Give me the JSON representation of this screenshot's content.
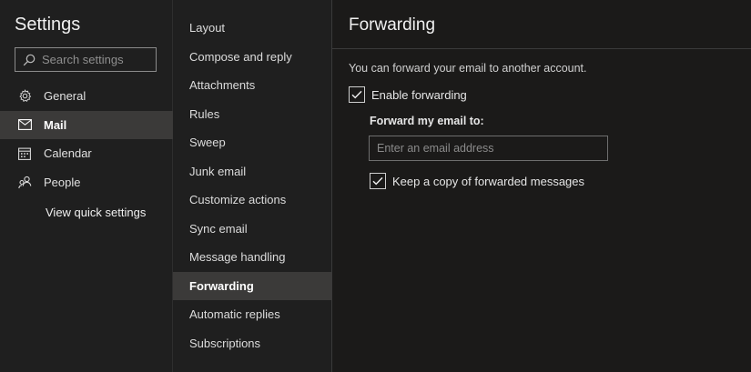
{
  "sidebar": {
    "title": "Settings",
    "search_placeholder": "Search settings",
    "items": [
      {
        "label": "General",
        "icon": "gear-icon",
        "active": false
      },
      {
        "label": "Mail",
        "icon": "mail-icon",
        "active": true
      },
      {
        "label": "Calendar",
        "icon": "calendar-icon",
        "active": false
      },
      {
        "label": "People",
        "icon": "people-icon",
        "active": false
      }
    ],
    "quick_settings": "View quick settings"
  },
  "mail_nav": {
    "items": [
      {
        "label": "Layout",
        "active": false
      },
      {
        "label": "Compose and reply",
        "active": false
      },
      {
        "label": "Attachments",
        "active": false
      },
      {
        "label": "Rules",
        "active": false
      },
      {
        "label": "Sweep",
        "active": false
      },
      {
        "label": "Junk email",
        "active": false
      },
      {
        "label": "Customize actions",
        "active": false
      },
      {
        "label": "Sync email",
        "active": false
      },
      {
        "label": "Message handling",
        "active": false
      },
      {
        "label": "Forwarding",
        "active": true
      },
      {
        "label": "Automatic replies",
        "active": false
      },
      {
        "label": "Subscriptions",
        "active": false
      }
    ]
  },
  "panel": {
    "title": "Forwarding",
    "description": "You can forward your email to another account.",
    "enable_label": "Enable forwarding",
    "enable_checked": true,
    "forward_label": "Forward my email to:",
    "email_value": "",
    "email_placeholder": "Enter an email address",
    "keep_copy_label": "Keep a copy of forwarded messages",
    "keep_copy_checked": true
  },
  "colors": {
    "background": "#1b1a19",
    "pane": "#1f1f1f",
    "active_item": "#3b3a39",
    "text": "#e6e6e6"
  }
}
